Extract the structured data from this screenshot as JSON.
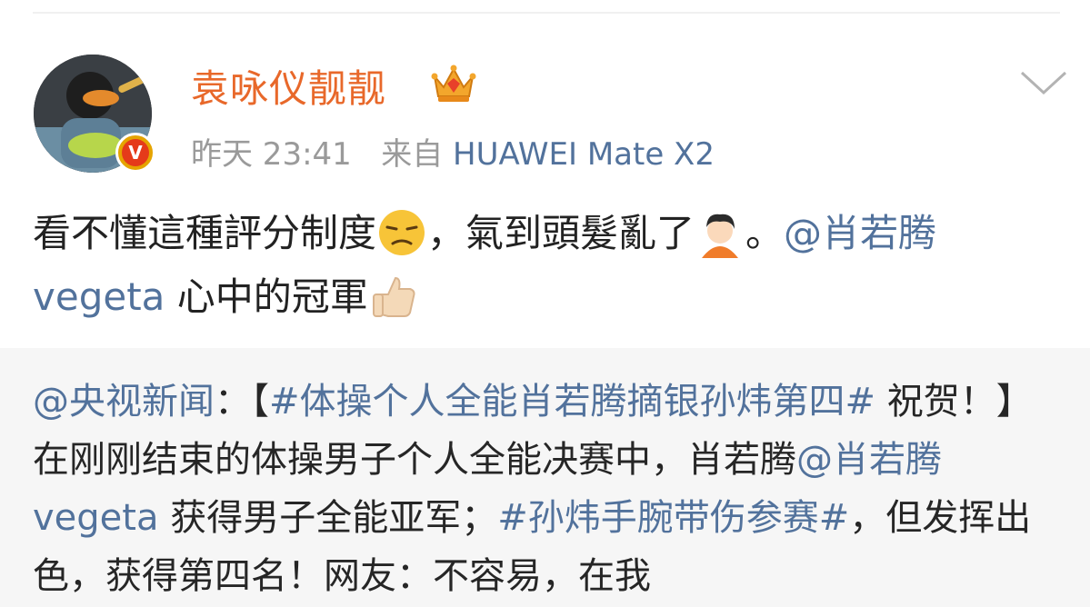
{
  "post": {
    "username": "袁咏仪靓靓",
    "time": "昨天 23:41",
    "source_prefix": "来自",
    "device": "HUAWEI Mate X2",
    "text_part1": "看不懂這種評分制度",
    "text_part2": "，氣到頭髮亂了",
    "text_part3": "。",
    "mention1": "@肖若腾vegeta",
    "text_part4": " 心中的冠軍"
  },
  "repost": {
    "mention": "@央视新闻",
    "colon_bracket": "：【",
    "hashtag1": "#体操个人全能肖若腾摘银孙炜第四#",
    "text1": " 祝贺！】在刚刚结束的体操男子个人全能决赛中，肖若腾",
    "mention2": "@肖若腾vegeta",
    "text2": " 获得男子全能亚军；",
    "hashtag2": "#孙炜手腕带伤参赛#",
    "text3": "，但发挥出色，获得第四名！网友：不容易，在我"
  },
  "colors": {
    "username": "#e8682a",
    "link": "#52729c",
    "meta": "#9a9a9a"
  }
}
